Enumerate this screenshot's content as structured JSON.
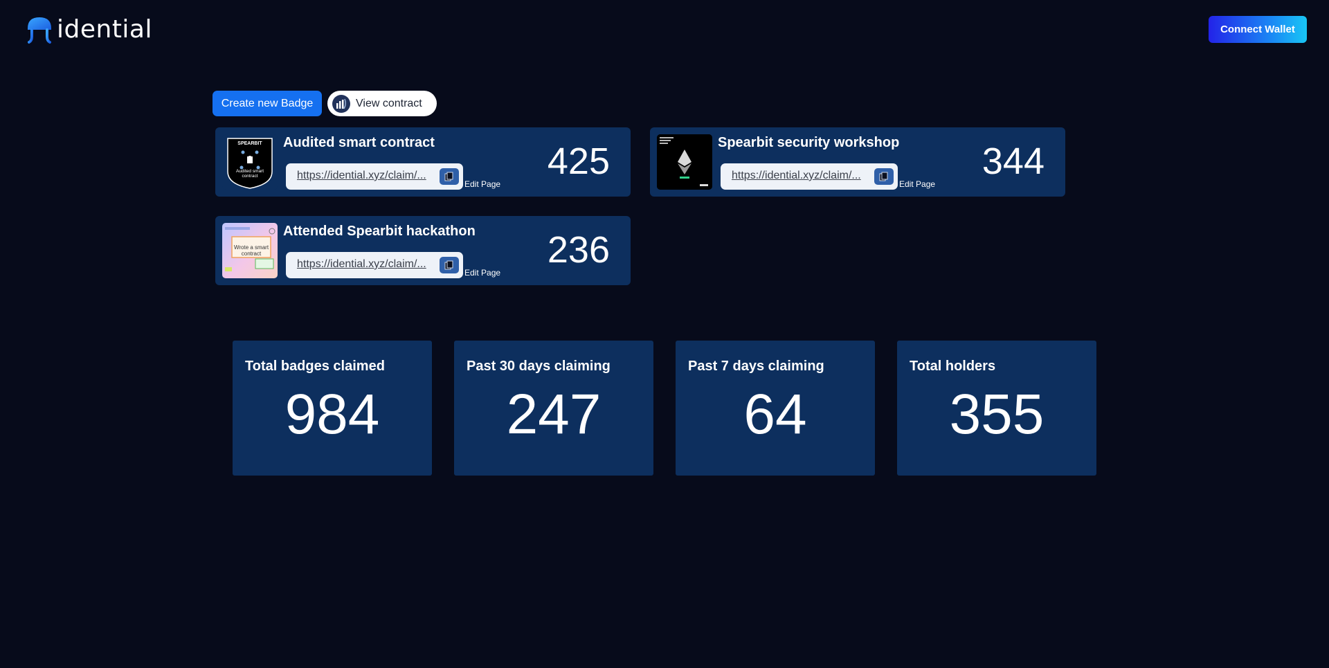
{
  "header": {
    "logo_text": "idential",
    "connect_wallet_label": "Connect Wallet"
  },
  "actions": {
    "create_badge_label": "Create new Badge",
    "view_contract_label": "View contract"
  },
  "badges": [
    {
      "title": "Audited smart contract",
      "claim_link": "https://idential.xyz/claim/...",
      "edit_label": "Edit Page",
      "count": "425",
      "thumb_top_text": "SPEARBIT",
      "thumb_bottom_text": "Audited smart contract"
    },
    {
      "title": "Spearbit security workshop",
      "claim_link": "https://idential.xyz/claim/...",
      "edit_label": "Edit Page",
      "count": "344"
    },
    {
      "title": "Attended Spearbit hackathon",
      "claim_link": "https://idential.xyz/claim/...",
      "edit_label": "Edit Page",
      "count": "236",
      "thumb_text": "Wrote a smart contract"
    }
  ],
  "stats": [
    {
      "label": "Total badges claimed",
      "value": "984"
    },
    {
      "label": "Past 30 days claiming",
      "value": "247"
    },
    {
      "label": "Past 7 days claiming",
      "value": "64"
    },
    {
      "label": "Total holders",
      "value": "355"
    }
  ],
  "colors": {
    "background": "#070b1b",
    "card": "#0d2f5e",
    "primary_button": "#1570f0",
    "wallet_gradient_start": "#2323e8",
    "wallet_gradient_end": "#19c6f5"
  },
  "icons": {
    "logo": "jellyfish-logo-icon",
    "view_contract": "etherscan-icon",
    "copy": "copy-icon"
  }
}
